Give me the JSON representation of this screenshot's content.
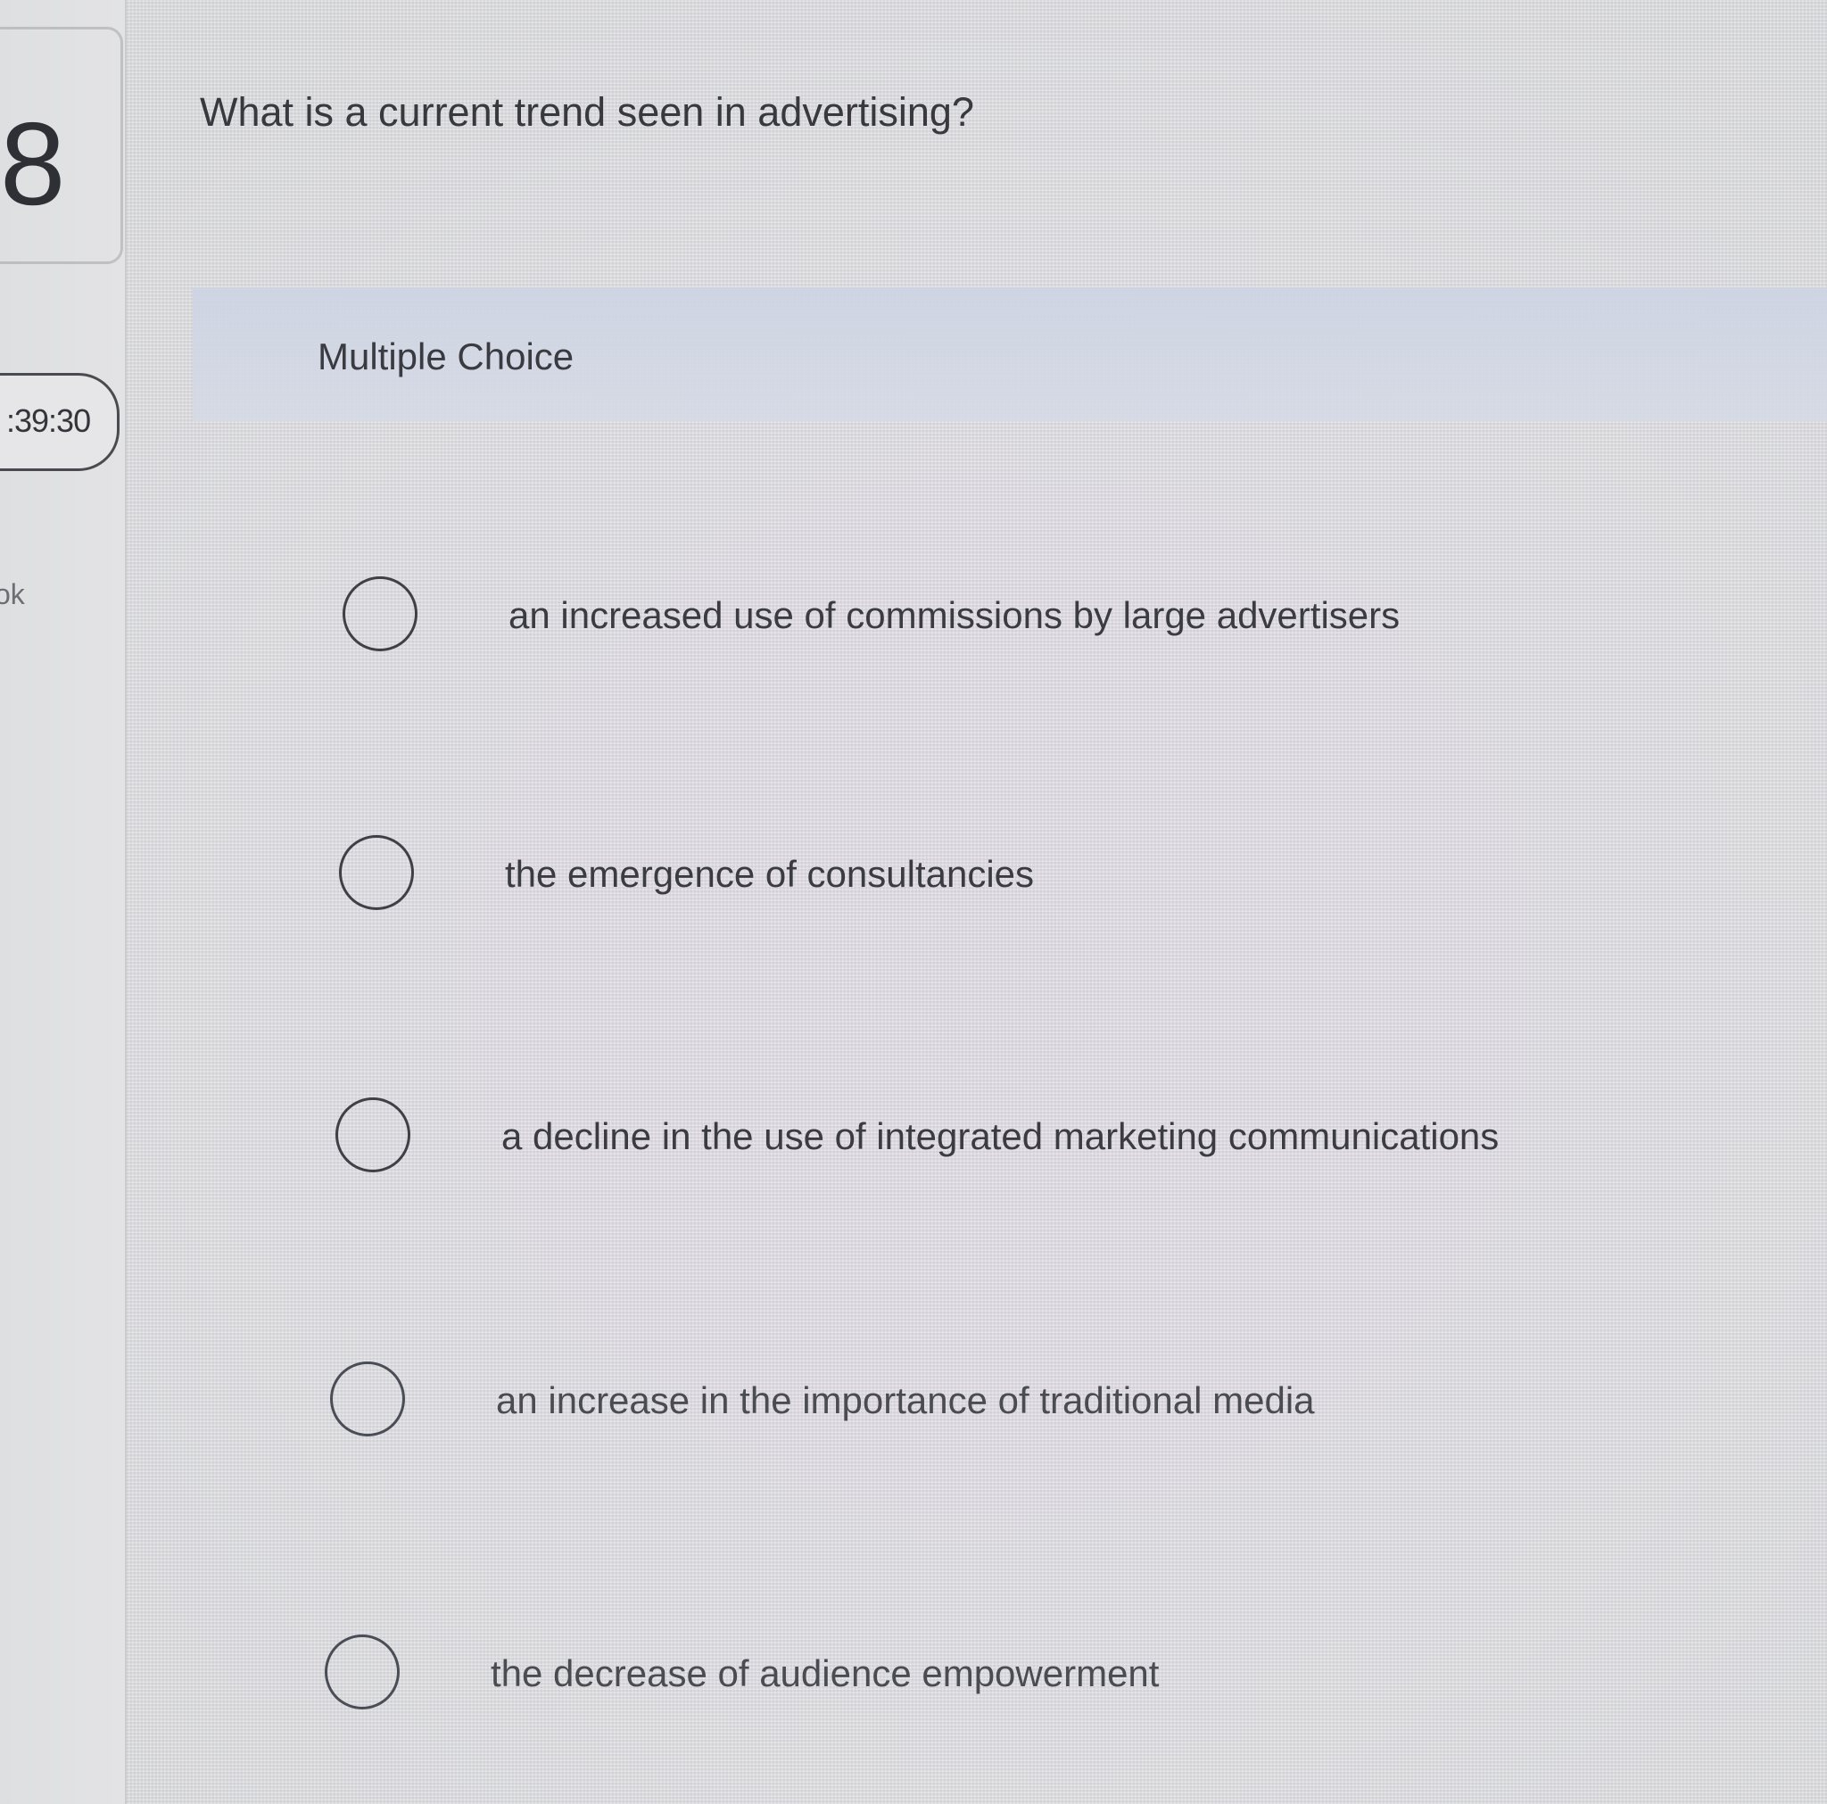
{
  "sidebar": {
    "question_number": "8",
    "timer": ":39:30",
    "link_fragment": "ok"
  },
  "question": {
    "text": "What is a current trend seen in advertising?",
    "type_label": "Multiple Choice"
  },
  "choices": [
    {
      "label": "an increased use of commissions by large advertisers",
      "selected": false
    },
    {
      "label": "the emergence of consultancies",
      "selected": false
    },
    {
      "label": "a decline in the use of integrated marketing communications",
      "selected": false
    },
    {
      "label": "an increase in the importance of traditional media",
      "selected": false
    },
    {
      "label": "the decrease of audience empowerment",
      "selected": false
    }
  ],
  "colors": {
    "background": "#e4e4e6",
    "header_band": "#d0d6e3",
    "text": "#3a3a3c",
    "radio_border": "#3e4046"
  }
}
